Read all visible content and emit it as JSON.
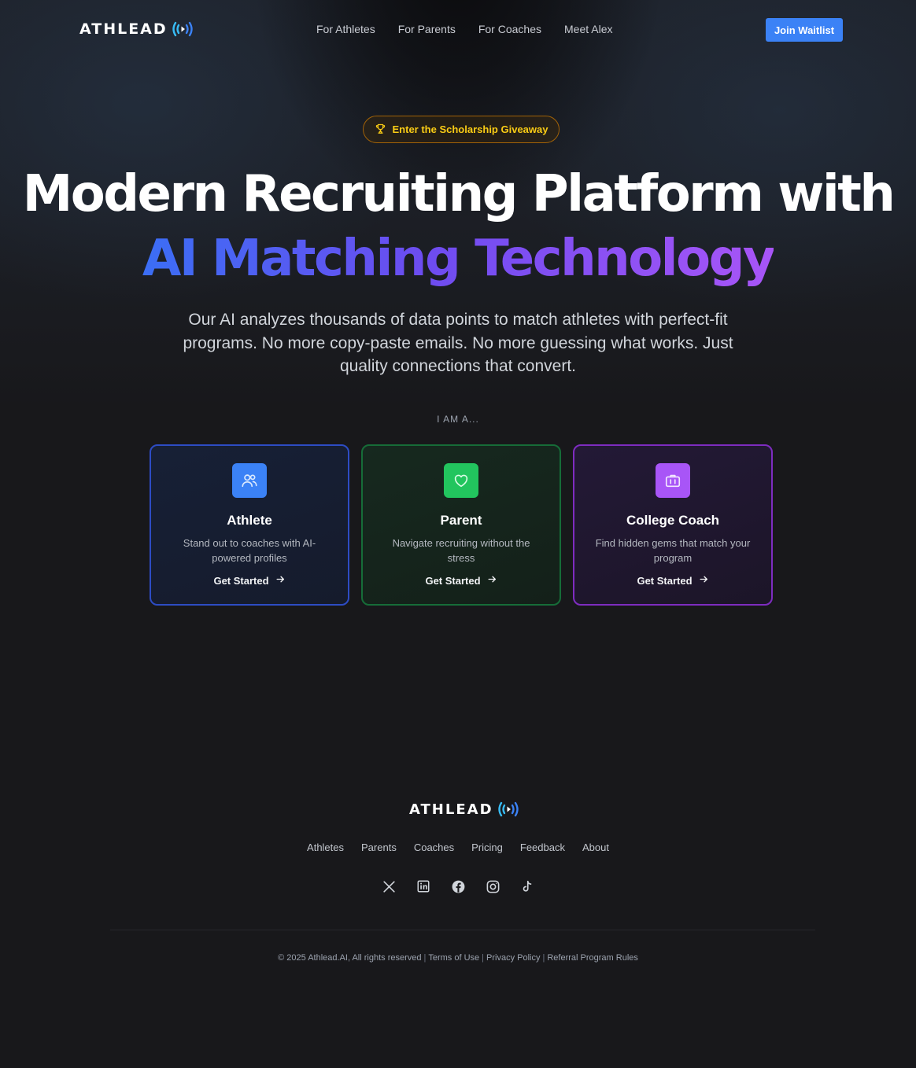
{
  "brand": {
    "name": "ATHLEAD",
    "accent": "#38bdf8",
    "primary": "#3b82f6"
  },
  "nav": {
    "links": [
      "For Athletes",
      "For Parents",
      "For Coaches",
      "Meet Alex"
    ],
    "cta": "Join Waitlist"
  },
  "hero": {
    "badge": "Enter the Scholarship Giveaway",
    "headline_line1": "Modern Recruiting Platform with",
    "headline_line2": "AI Matching Technology",
    "subtext": "Our AI analyzes thousands of data points to match athletes with perfect-fit programs. No more copy-paste emails. No more guessing what works. Just quality connections that convert.",
    "iam_label": "I AM A..."
  },
  "cards": [
    {
      "title": "Athlete",
      "desc": "Stand out to coaches with AI-powered profiles",
      "cta": "Get Started",
      "icon": "users-icon",
      "color": "#3b82f6"
    },
    {
      "title": "Parent",
      "desc": "Navigate recruiting without the stress",
      "cta": "Get Started",
      "icon": "heart-icon",
      "color": "#22c55e"
    },
    {
      "title": "College Coach",
      "desc": "Find hidden gems that match your program",
      "cta": "Get Started",
      "icon": "briefcase-icon",
      "color": "#a855f7"
    }
  ],
  "footer": {
    "links": [
      "Athletes",
      "Parents",
      "Coaches",
      "Pricing",
      "Feedback",
      "About"
    ],
    "social": [
      "x-icon",
      "linkedin-icon",
      "facebook-icon",
      "instagram-icon",
      "tiktok-icon"
    ],
    "copyright": "© 2025 Athlead.AI, All rights reserved",
    "legal_links": [
      "Terms of Use",
      "Privacy Policy",
      "Referral Program Rules"
    ]
  }
}
